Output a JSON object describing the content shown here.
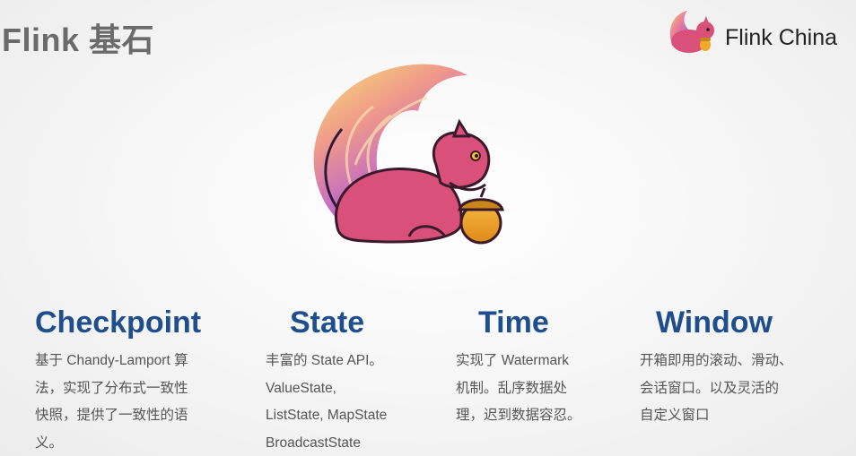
{
  "slide": {
    "title": "Flink 基石",
    "brand": {
      "text": "Flink China",
      "logo_icon": "squirrel-logo-icon"
    },
    "mascot_icon": "flink-squirrel-icon",
    "columns": [
      {
        "heading": "Checkpoint",
        "lines": [
          "基于 Chandy-Lamport 算",
          "法，实现了分布式一致性",
          "快照，提供了一致性的语",
          "义。"
        ]
      },
      {
        "heading": "State",
        "lines": [
          "丰富的 State API。",
          "ValueState,",
          "ListState, MapState",
          "BroadcastState"
        ]
      },
      {
        "heading": "Time",
        "lines": [
          "实现了 Watermark",
          "机制。乱序数据处",
          "理，迟到数据容忍。"
        ]
      },
      {
        "heading": "Window",
        "lines": [
          "开箱即用的滚动、滑动、",
          "会话窗口。以及灵活的",
          "自定义窗口"
        ]
      }
    ],
    "colors": {
      "heading": "#1f4e8c",
      "title": "#6b6b6b",
      "body": "#555555",
      "squirrel": "#d9507a"
    }
  }
}
